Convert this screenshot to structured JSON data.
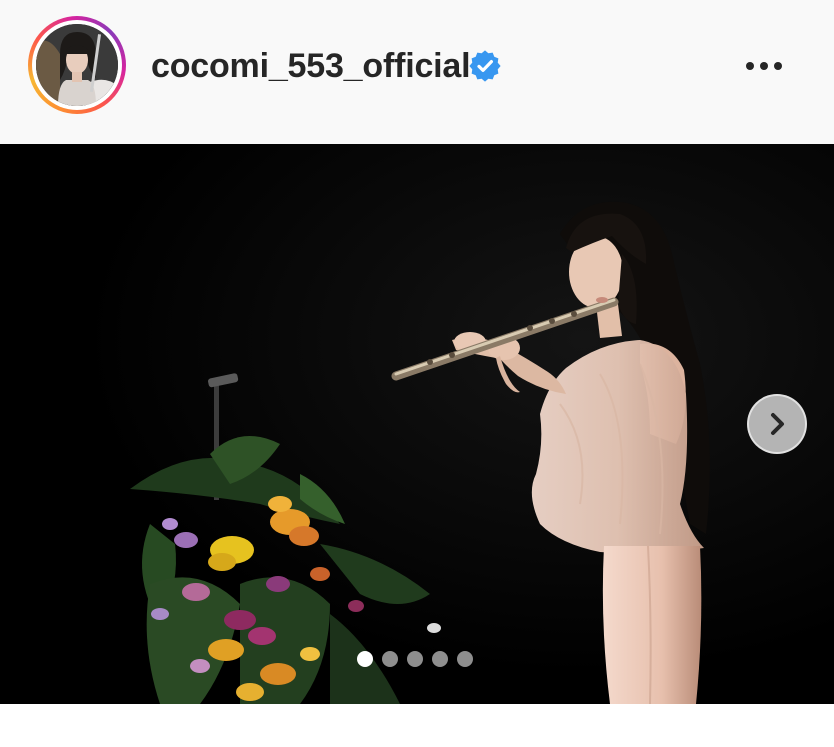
{
  "post": {
    "username": "cocomi_553_official",
    "verified": true,
    "verified_icon": "verified-badge-icon",
    "more_icon": "more-horizontal-icon",
    "next_icon": "chevron-right-icon",
    "carousel": {
      "total_slides": 5,
      "current_slide": 1
    },
    "colors": {
      "header_bg": "#f9f9f9",
      "username": "#262626",
      "verified_blue": "#3897f0",
      "media_bg": "#000000",
      "dot_active": "#ffffff",
      "dot_inactive": "#8e8e8e"
    }
  }
}
